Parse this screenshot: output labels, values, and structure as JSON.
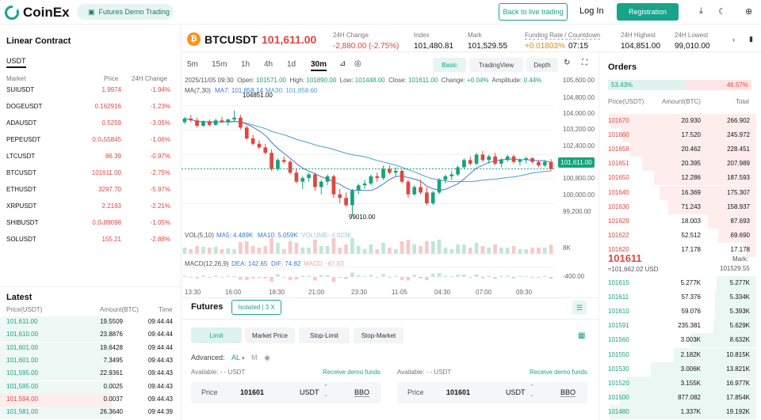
{
  "header": {
    "logo": "CoinEx",
    "demo_pill": "Futures Demo Trading",
    "back_live": "Back to live trading",
    "login": "Log In",
    "register": "Registration"
  },
  "left": {
    "title": "Linear Contract",
    "tab": "USDT",
    "market_headers": {
      "market": "Market",
      "price": "Price",
      "change": "24H Change"
    },
    "markets": [
      {
        "name": "SUIUSDT",
        "price": "1.9974",
        "change": "-1.94%"
      },
      {
        "name": "DOGEUSDT",
        "price": "0.162916",
        "change": "-1.23%"
      },
      {
        "name": "ADAUSDT",
        "price": "0.5259",
        "change": "-3.05%"
      },
      {
        "name": "PEPEUSDT",
        "price": "0.0₅55845",
        "change": "-1.06%"
      },
      {
        "name": "LTCUSDT",
        "price": "86.39",
        "change": "-0.97%"
      },
      {
        "name": "BTCUSDT",
        "price": "101611.00",
        "change": "-2.75%"
      },
      {
        "name": "ETHUSDT",
        "price": "3297.70",
        "change": "-5.97%"
      },
      {
        "name": "XRPUSDT",
        "price": "2.2193",
        "change": "-2.21%"
      },
      {
        "name": "SHIBUSDT",
        "price": "0.0₅89098",
        "change": "-1.05%"
      },
      {
        "name": "SOLUSDT",
        "price": "155.21",
        "change": "-2.88%"
      }
    ],
    "latest_title": "Latest",
    "latest_headers": {
      "price": "Price(USDT)",
      "amount": "Amount(BTC)",
      "time": "Time"
    },
    "latest": [
      {
        "price": "101,611.00",
        "amount": "19.5509",
        "time": "09:44:44",
        "side": "buy"
      },
      {
        "price": "101,610.00",
        "amount": "23.8876",
        "time": "09:44:44",
        "side": "buy"
      },
      {
        "price": "101,601.00",
        "amount": "19.6428",
        "time": "09:44:44",
        "side": "buy"
      },
      {
        "price": "101,601.00",
        "amount": "7.3495",
        "time": "09:44:43",
        "side": "buy"
      },
      {
        "price": "101,595.00",
        "amount": "22.9361",
        "time": "09:44:43",
        "side": "buy"
      },
      {
        "price": "101,595.00",
        "amount": "0.0025",
        "time": "09:44:43",
        "side": "buy"
      },
      {
        "price": "101,594.00",
        "amount": "0.0037",
        "time": "09:44:43",
        "side": "sell"
      },
      {
        "price": "101,581.00",
        "amount": "26.3640",
        "time": "09:44:39",
        "side": "buy"
      }
    ]
  },
  "ticker": {
    "symbol": "BTCUSDT",
    "last": "101,611.00",
    "coin_letter": "₿",
    "stats": [
      {
        "label": "24H Change",
        "value": "-2,880.00 (-2.75%)",
        "color": "red"
      },
      {
        "label": "Index",
        "value": "101,480.81",
        "color": ""
      },
      {
        "label": "Mark",
        "value": "101,529.55",
        "color": ""
      },
      {
        "label": "Funding Rate / Countdown",
        "value": "+0.01803%",
        "value2": "07:15",
        "color": "orange"
      },
      {
        "label": "24H Highest",
        "value": "104,851.00",
        "color": ""
      },
      {
        "label": "24H Lowest",
        "value": "99,010.00",
        "color": ""
      }
    ]
  },
  "chart_bar": {
    "timeframes": [
      "5m",
      "15m",
      "1h",
      "4h",
      "1d",
      "30m"
    ],
    "active": "30m",
    "views": [
      "Basic",
      "TradingView",
      "Depth"
    ]
  },
  "ohlc": {
    "date": "2025/11/05 09:30",
    "open_l": "Open:",
    "open": "101571.00",
    "high_l": "High:",
    "high": "101890.00",
    "low_l": "Low:",
    "low": "101448.00",
    "close_l": "Close:",
    "close": "101611.00",
    "change_l": "Change:",
    "change": "+0.04%",
    "amp_l": "Amplitude:",
    "amp": "0.44%"
  },
  "ma": {
    "label": "MA(7,30)",
    "ma7": "MA7: 101,858.14",
    "ma30": "MA30: 101,858.60"
  },
  "price_axis": [
    "105,600.00",
    "104,800.00",
    "104,000.00",
    "103,200.00",
    "102,400.00",
    "100,800.00",
    "100,000.00",
    "99,200.00"
  ],
  "current_price_tag": "101,611.00",
  "annot": {
    "high": "104851.00",
    "low": "99010.00"
  },
  "vol": {
    "label": "VOL(5,10)",
    "ma5": "MA5: 4.489K",
    "ma10": "MA10: 5.059K",
    "volume": "VOLUME: 4.023K",
    "axis": "8K"
  },
  "macd": {
    "label": "MACD(12,26,9)",
    "dea": "DEA: 142.65",
    "dif": "DIF: 74.82",
    "macd": "MACD: -67.83",
    "axis": "-400.00"
  },
  "time_axis": [
    "13:30",
    "16:00",
    "18:30",
    "21:00",
    "23:30",
    "11-05",
    "04:30",
    "07:00",
    "09:30"
  ],
  "chart_data": {
    "type": "candlestick",
    "candles": [
      [
        104200,
        104500,
        104100,
        104400
      ],
      [
        104400,
        104600,
        104200,
        104300
      ],
      [
        104300,
        104450,
        103900,
        104000
      ],
      [
        104000,
        104300,
        103950,
        104250
      ],
      [
        104250,
        104350,
        103950,
        104050
      ],
      [
        104050,
        104400,
        104000,
        104300
      ],
      [
        104300,
        104500,
        104150,
        104200
      ],
      [
        104200,
        104400,
        104000,
        104350
      ],
      [
        104350,
        104851,
        104250,
        104450
      ],
      [
        104450,
        104600,
        103800,
        103900
      ],
      [
        103900,
        104000,
        103200,
        103300
      ],
      [
        103300,
        103500,
        102900,
        103000
      ],
      [
        103000,
        103200,
        102700,
        102800
      ],
      [
        102800,
        103000,
        102400,
        102500
      ],
      [
        102500,
        102700,
        101500,
        101600
      ],
      [
        101600,
        102200,
        101500,
        102100
      ],
      [
        102100,
        102300,
        101900,
        102000
      ],
      [
        102000,
        102100,
        101300,
        101400
      ],
      [
        101400,
        101600,
        100800,
        100900
      ],
      [
        100900,
        101200,
        100500,
        101100
      ],
      [
        101100,
        101400,
        100900,
        101300
      ],
      [
        101300,
        101400,
        100400,
        100600
      ],
      [
        100600,
        101000,
        100200,
        100900
      ],
      [
        100900,
        101300,
        100700,
        101200
      ],
      [
        101200,
        101300,
        100000,
        100200
      ],
      [
        100200,
        100500,
        99700,
        100000
      ],
      [
        100000,
        100300,
        99500,
        99600
      ],
      [
        99600,
        100500,
        99010,
        100400
      ],
      [
        100400,
        100800,
        100200,
        100700
      ],
      [
        100700,
        101000,
        100500,
        100800
      ],
      [
        100800,
        101300,
        100700,
        101200
      ],
      [
        101200,
        101400,
        100900,
        101100
      ],
      [
        101100,
        101800,
        101000,
        101600
      ],
      [
        101600,
        101800,
        101300,
        101400
      ],
      [
        101400,
        101700,
        101200,
        101500
      ],
      [
        101500,
        101600,
        100800,
        100900
      ],
      [
        100900,
        101000,
        100000,
        100200
      ],
      [
        100200,
        100700,
        100100,
        100600
      ],
      [
        100600,
        101000,
        100200,
        100300
      ],
      [
        100300,
        100600,
        99600,
        99700
      ],
      [
        99700,
        100400,
        99600,
        100300
      ],
      [
        100300,
        101100,
        100200,
        101000
      ],
      [
        101000,
        101300,
        100800,
        101200
      ],
      [
        101200,
        101500,
        101000,
        101300
      ],
      [
        101300,
        101800,
        101200,
        101700
      ],
      [
        101700,
        102200,
        101600,
        102100
      ],
      [
        102100,
        102300,
        101800,
        101900
      ],
      [
        101900,
        102500,
        101800,
        102400
      ],
      [
        102400,
        102600,
        102000,
        102100
      ],
      [
        102100,
        102400,
        101900,
        102300
      ],
      [
        102300,
        102500,
        101800,
        101900
      ],
      [
        101900,
        102200,
        101700,
        102100
      ],
      [
        102100,
        102400,
        102000,
        102300
      ],
      [
        102300,
        102400,
        101900,
        102000
      ],
      [
        102000,
        102200,
        101800,
        102100
      ],
      [
        102100,
        102300,
        101900,
        102200
      ],
      [
        102200,
        102250,
        101900,
        102000
      ],
      [
        102000,
        102100,
        101700,
        101800
      ],
      [
        101800,
        102100,
        101700,
        102000
      ],
      [
        102000,
        102150,
        101500,
        101611
      ]
    ],
    "ylim": [
      99000,
      105800
    ]
  },
  "futures": {
    "title": "Futures",
    "mode": "Isolated | 3 X",
    "tabs": [
      "Limit",
      "Market Price",
      "Stop-Limit",
      "Stop-Market"
    ],
    "advanced": "Advanced:",
    "adv_val": "AL",
    "adv_m": "M",
    "available": "Available: - - USDT",
    "receive": "Receive demo funds",
    "price_label": "Price",
    "price_value": "101601",
    "unit": "USDT",
    "bbo": "BBO"
  },
  "orders": {
    "title": "Orders",
    "buy_ratio": "53.43%",
    "sell_ratio": "46.57%",
    "headers": {
      "price": "Price(USDT)",
      "amount": "Amount(BTC)",
      "total": "Total"
    },
    "asks": [
      {
        "price": "101670",
        "amount": "20.930",
        "total": "266.902",
        "depth": 1.0
      },
      {
        "price": "101660",
        "amount": "17.520",
        "total": "245.972",
        "depth": 0.92
      },
      {
        "price": "101658",
        "amount": "20.462",
        "total": "228.451",
        "depth": 0.86
      },
      {
        "price": "101651",
        "amount": "20.395",
        "total": "207.989",
        "depth": 0.78
      },
      {
        "price": "101650",
        "amount": "12.286",
        "total": "187.593",
        "depth": 0.7
      },
      {
        "price": "101640",
        "amount": "16.369",
        "total": "175.307",
        "depth": 0.66
      },
      {
        "price": "101630",
        "amount": "71.243",
        "total": "158.937",
        "depth": 0.6
      },
      {
        "price": "101629",
        "amount": "18.003",
        "total": "87.693",
        "depth": 0.33
      },
      {
        "price": "101622",
        "amount": "52.512",
        "total": "69.690",
        "depth": 0.26
      },
      {
        "price": "101620",
        "amount": "17.178",
        "total": "17.178",
        "depth": 0.07
      }
    ],
    "mid": "101611",
    "mid_sub": "≈101,662.02  USD",
    "mark_l": "Mark:",
    "mark_v": "101529.55",
    "bids": [
      {
        "price": "101615",
        "amount": "5.277K",
        "total": "5.277K",
        "depth": 0.27
      },
      {
        "price": "101611",
        "amount": "57.376",
        "total": "5.334K",
        "depth": 0.28
      },
      {
        "price": "101610",
        "amount": "59.076",
        "total": "5.393K",
        "depth": 0.28
      },
      {
        "price": "101591",
        "amount": "235.381",
        "total": "5.629K",
        "depth": 0.29
      },
      {
        "price": "101560",
        "amount": "3.003K",
        "total": "8.632K",
        "depth": 0.45
      },
      {
        "price": "101550",
        "amount": "2.182K",
        "total": "10.815K",
        "depth": 0.56
      },
      {
        "price": "101530",
        "amount": "3.006K",
        "total": "13.821K",
        "depth": 0.72
      },
      {
        "price": "101520",
        "amount": "3.155K",
        "total": "16.977K",
        "depth": 0.88
      },
      {
        "price": "101500",
        "amount": "877.082",
        "total": "17.854K",
        "depth": 0.93
      },
      {
        "price": "101480",
        "amount": "1.337K",
        "total": "19.192K",
        "depth": 1.0
      }
    ]
  },
  "colors": {
    "accent": "#18a38a",
    "up": "#17a37c",
    "down": "#e0463f"
  }
}
